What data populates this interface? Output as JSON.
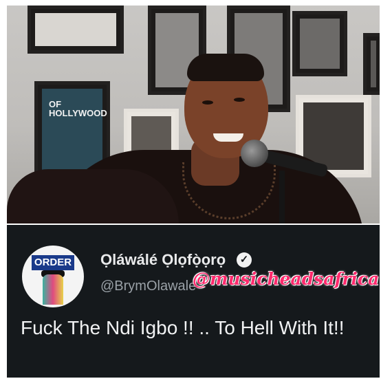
{
  "photo": {
    "description_icon": "photo-man-with-microphone",
    "poster_text": "OF HOLLYWOOD"
  },
  "tweet": {
    "display_name": "Ọláwálé Ọlọfọ̀ọrọ",
    "handle": "@BrymOlawale",
    "watermark": "@musicheadsafrica",
    "text": "Fuck The Ndi Igbo !! .. To Hell With It!!",
    "avatar_label": "ORDER",
    "verified_icon": "check-icon"
  },
  "colors": {
    "tweet_bg": "#15191c",
    "watermark": "#ff2a6d"
  }
}
